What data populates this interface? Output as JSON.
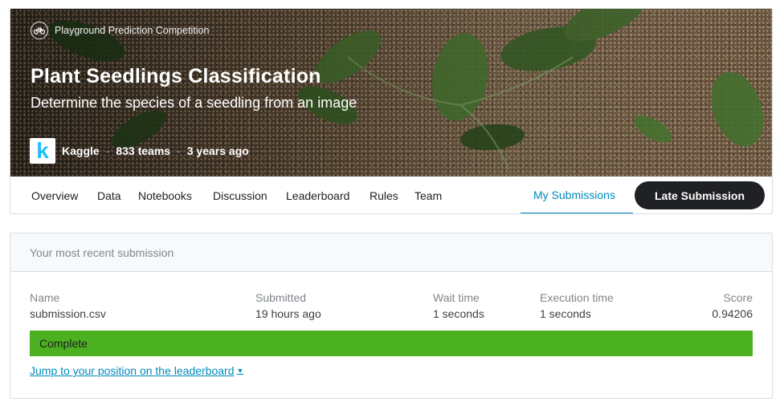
{
  "competition": {
    "type_label": "Playground Prediction Competition",
    "type_icon": "bicycle-icon",
    "title": "Plant Seedlings Classification",
    "subtitle": "Determine the species of a seedling from an image",
    "host_logo": "k",
    "host": "Kaggle",
    "teams": "833 teams",
    "age": "3 years ago",
    "separator": "·"
  },
  "tabs": [
    {
      "label": "Overview"
    },
    {
      "label": "Data"
    },
    {
      "label": "Notebooks"
    },
    {
      "label": "Discussion"
    },
    {
      "label": "Leaderboard"
    },
    {
      "label": "Rules"
    },
    {
      "label": "Team"
    },
    {
      "label": "My Submissions",
      "active": true
    }
  ],
  "late_submission_label": "Late Submission",
  "recent_submission": {
    "header": "Your most recent submission",
    "columns": [
      {
        "header": "Name",
        "value": "submission.csv"
      },
      {
        "header": "Submitted",
        "value": "19 hours ago"
      },
      {
        "header": "Wait time",
        "value": "1 seconds"
      },
      {
        "header": "Execution time",
        "value": "1 seconds"
      },
      {
        "header": "Score",
        "value": "0.94206"
      }
    ],
    "status": "Complete",
    "jump_link": "Jump to your position on the leaderboard",
    "jump_icon": "caret-down-icon"
  },
  "colors": {
    "accent": "#008abc",
    "kaggle_blue": "#20beff",
    "status_complete": "#4bb121",
    "button_dark": "#202124"
  }
}
